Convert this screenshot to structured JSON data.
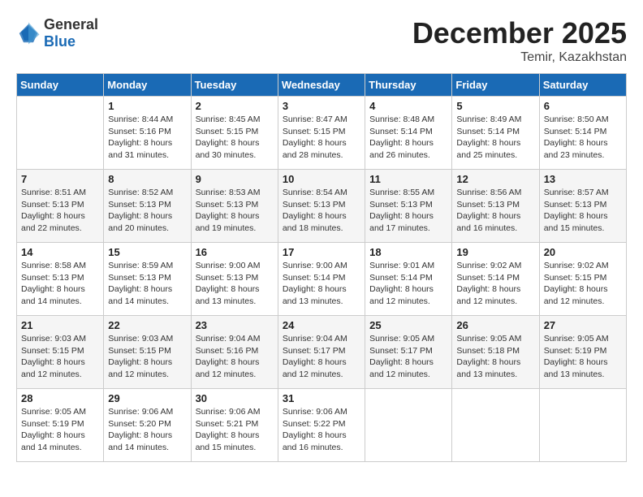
{
  "header": {
    "logo": {
      "text_general": "General",
      "text_blue": "Blue"
    },
    "title": "December 2025",
    "location": "Temir, Kazakhstan"
  },
  "weekdays": [
    "Sunday",
    "Monday",
    "Tuesday",
    "Wednesday",
    "Thursday",
    "Friday",
    "Saturday"
  ],
  "weeks": [
    [
      {
        "day": "",
        "sunrise": "",
        "sunset": "",
        "daylight": ""
      },
      {
        "day": "1",
        "sunrise": "Sunrise: 8:44 AM",
        "sunset": "Sunset: 5:16 PM",
        "daylight": "Daylight: 8 hours and 31 minutes."
      },
      {
        "day": "2",
        "sunrise": "Sunrise: 8:45 AM",
        "sunset": "Sunset: 5:15 PM",
        "daylight": "Daylight: 8 hours and 30 minutes."
      },
      {
        "day": "3",
        "sunrise": "Sunrise: 8:47 AM",
        "sunset": "Sunset: 5:15 PM",
        "daylight": "Daylight: 8 hours and 28 minutes."
      },
      {
        "day": "4",
        "sunrise": "Sunrise: 8:48 AM",
        "sunset": "Sunset: 5:14 PM",
        "daylight": "Daylight: 8 hours and 26 minutes."
      },
      {
        "day": "5",
        "sunrise": "Sunrise: 8:49 AM",
        "sunset": "Sunset: 5:14 PM",
        "daylight": "Daylight: 8 hours and 25 minutes."
      },
      {
        "day": "6",
        "sunrise": "Sunrise: 8:50 AM",
        "sunset": "Sunset: 5:14 PM",
        "daylight": "Daylight: 8 hours and 23 minutes."
      }
    ],
    [
      {
        "day": "7",
        "sunrise": "Sunrise: 8:51 AM",
        "sunset": "Sunset: 5:13 PM",
        "daylight": "Daylight: 8 hours and 22 minutes."
      },
      {
        "day": "8",
        "sunrise": "Sunrise: 8:52 AM",
        "sunset": "Sunset: 5:13 PM",
        "daylight": "Daylight: 8 hours and 20 minutes."
      },
      {
        "day": "9",
        "sunrise": "Sunrise: 8:53 AM",
        "sunset": "Sunset: 5:13 PM",
        "daylight": "Daylight: 8 hours and 19 minutes."
      },
      {
        "day": "10",
        "sunrise": "Sunrise: 8:54 AM",
        "sunset": "Sunset: 5:13 PM",
        "daylight": "Daylight: 8 hours and 18 minutes."
      },
      {
        "day": "11",
        "sunrise": "Sunrise: 8:55 AM",
        "sunset": "Sunset: 5:13 PM",
        "daylight": "Daylight: 8 hours and 17 minutes."
      },
      {
        "day": "12",
        "sunrise": "Sunrise: 8:56 AM",
        "sunset": "Sunset: 5:13 PM",
        "daylight": "Daylight: 8 hours and 16 minutes."
      },
      {
        "day": "13",
        "sunrise": "Sunrise: 8:57 AM",
        "sunset": "Sunset: 5:13 PM",
        "daylight": "Daylight: 8 hours and 15 minutes."
      }
    ],
    [
      {
        "day": "14",
        "sunrise": "Sunrise: 8:58 AM",
        "sunset": "Sunset: 5:13 PM",
        "daylight": "Daylight: 8 hours and 14 minutes."
      },
      {
        "day": "15",
        "sunrise": "Sunrise: 8:59 AM",
        "sunset": "Sunset: 5:13 PM",
        "daylight": "Daylight: 8 hours and 14 minutes."
      },
      {
        "day": "16",
        "sunrise": "Sunrise: 9:00 AM",
        "sunset": "Sunset: 5:13 PM",
        "daylight": "Daylight: 8 hours and 13 minutes."
      },
      {
        "day": "17",
        "sunrise": "Sunrise: 9:00 AM",
        "sunset": "Sunset: 5:14 PM",
        "daylight": "Daylight: 8 hours and 13 minutes."
      },
      {
        "day": "18",
        "sunrise": "Sunrise: 9:01 AM",
        "sunset": "Sunset: 5:14 PM",
        "daylight": "Daylight: 8 hours and 12 minutes."
      },
      {
        "day": "19",
        "sunrise": "Sunrise: 9:02 AM",
        "sunset": "Sunset: 5:14 PM",
        "daylight": "Daylight: 8 hours and 12 minutes."
      },
      {
        "day": "20",
        "sunrise": "Sunrise: 9:02 AM",
        "sunset": "Sunset: 5:15 PM",
        "daylight": "Daylight: 8 hours and 12 minutes."
      }
    ],
    [
      {
        "day": "21",
        "sunrise": "Sunrise: 9:03 AM",
        "sunset": "Sunset: 5:15 PM",
        "daylight": "Daylight: 8 hours and 12 minutes."
      },
      {
        "day": "22",
        "sunrise": "Sunrise: 9:03 AM",
        "sunset": "Sunset: 5:15 PM",
        "daylight": "Daylight: 8 hours and 12 minutes."
      },
      {
        "day": "23",
        "sunrise": "Sunrise: 9:04 AM",
        "sunset": "Sunset: 5:16 PM",
        "daylight": "Daylight: 8 hours and 12 minutes."
      },
      {
        "day": "24",
        "sunrise": "Sunrise: 9:04 AM",
        "sunset": "Sunset: 5:17 PM",
        "daylight": "Daylight: 8 hours and 12 minutes."
      },
      {
        "day": "25",
        "sunrise": "Sunrise: 9:05 AM",
        "sunset": "Sunset: 5:17 PM",
        "daylight": "Daylight: 8 hours and 12 minutes."
      },
      {
        "day": "26",
        "sunrise": "Sunrise: 9:05 AM",
        "sunset": "Sunset: 5:18 PM",
        "daylight": "Daylight: 8 hours and 13 minutes."
      },
      {
        "day": "27",
        "sunrise": "Sunrise: 9:05 AM",
        "sunset": "Sunset: 5:19 PM",
        "daylight": "Daylight: 8 hours and 13 minutes."
      }
    ],
    [
      {
        "day": "28",
        "sunrise": "Sunrise: 9:05 AM",
        "sunset": "Sunset: 5:19 PM",
        "daylight": "Daylight: 8 hours and 14 minutes."
      },
      {
        "day": "29",
        "sunrise": "Sunrise: 9:06 AM",
        "sunset": "Sunset: 5:20 PM",
        "daylight": "Daylight: 8 hours and 14 minutes."
      },
      {
        "day": "30",
        "sunrise": "Sunrise: 9:06 AM",
        "sunset": "Sunset: 5:21 PM",
        "daylight": "Daylight: 8 hours and 15 minutes."
      },
      {
        "day": "31",
        "sunrise": "Sunrise: 9:06 AM",
        "sunset": "Sunset: 5:22 PM",
        "daylight": "Daylight: 8 hours and 16 minutes."
      },
      {
        "day": "",
        "sunrise": "",
        "sunset": "",
        "daylight": ""
      },
      {
        "day": "",
        "sunrise": "",
        "sunset": "",
        "daylight": ""
      },
      {
        "day": "",
        "sunrise": "",
        "sunset": "",
        "daylight": ""
      }
    ]
  ]
}
